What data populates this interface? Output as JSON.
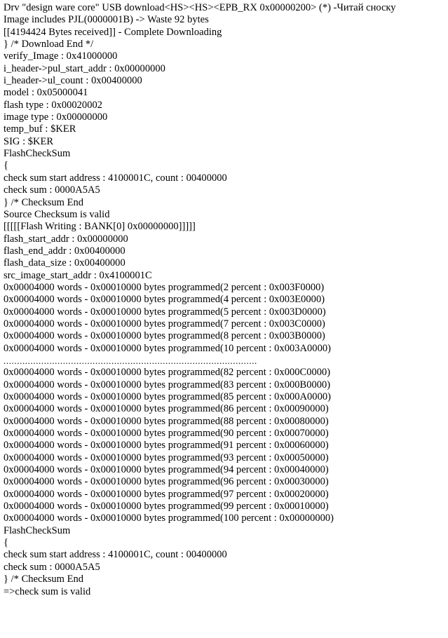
{
  "window": {
    "title": "Flash Download Console Log",
    "background_color": "#ffffff",
    "text_color": "#000000"
  },
  "console": {
    "name": "flash-download-log",
    "line_count": 48,
    "lines": [
      "Drv \"design ware core\" USB download<HS><HS><EPB_RX 0x00000200> (*) -Читай сноску",
      "Image includes PJL(0000001B) -> Waste 92 bytes",
      "[[4194424 Bytes received]] - Complete Downloading",
      "} /* Download End */",
      "verify_Image : 0x41000000",
      "i_header->pul_start_addr : 0x00000000",
      "i_header->ul_count : 0x00400000",
      "model : 0x05000041",
      "flash type : 0x00020002",
      "image type : 0x00000000",
      "temp_buf : $KER",
      "SIG : $KER",
      "FlashCheckSum",
      "{",
      "check sum start address : 4100001C, count : 00400000",
      "check sum : 0000A5A5",
      "} /* Checksum End",
      "Source Checksum is valid",
      "[[[[[Flash Writing : BANK[0] 0x00000000]]]]]",
      "flash_start_addr : 0x00000000",
      "flash_end_addr : 0x00400000",
      "flash_data_size : 0x00400000",
      "src_image_start_addr : 0x4100001C",
      "0x00004000 words - 0x00010000 bytes programmed(2 percent : 0x003F0000)",
      "0x00004000 words - 0x00010000 bytes programmed(4 percent : 0x003E0000)",
      "0x00004000 words - 0x00010000 bytes programmed(5 percent : 0x003D0000)",
      "0x00004000 words - 0x00010000 bytes programmed(7 percent : 0x003C0000)",
      "0x00004000 words - 0x00010000 bytes programmed(8 percent : 0x003B0000)",
      "0x00004000 words - 0x00010000 bytes programmed(10 percent : 0x003A0000)",
      "..............................................................................................",
      "0x00004000 words - 0x00010000 bytes programmed(82 percent : 0x000C0000)",
      "0x00004000 words - 0x00010000 bytes programmed(83 percent : 0x000B0000)",
      "0x00004000 words - 0x00010000 bytes programmed(85 percent : 0x000A0000)",
      "0x00004000 words - 0x00010000 bytes programmed(86 percent : 0x00090000)",
      "0x00004000 words - 0x00010000 bytes programmed(88 percent : 0x00080000)",
      "0x00004000 words - 0x00010000 bytes programmed(90 percent : 0x00070000)",
      "0x00004000 words - 0x00010000 bytes programmed(91 percent : 0x00060000)",
      "0x00004000 words - 0x00010000 bytes programmed(93 percent : 0x00050000)",
      "0x00004000 words - 0x00010000 bytes programmed(94 percent : 0x00040000)",
      "0x00004000 words - 0x00010000 bytes programmed(96 percent : 0x00030000)",
      "0x00004000 words - 0x00010000 bytes programmed(97 percent : 0x00020000)",
      "0x00004000 words - 0x00010000 bytes programmed(99 percent : 0x00010000)",
      "0x00004000 words - 0x00010000 bytes programmed(100 percent : 0x00000000)",
      "FlashCheckSum",
      "{",
      "check sum start address : 4100001C, count : 00400000",
      "check sum : 0000A5A5",
      "} /* Checksum End",
      "=>check sum is valid"
    ],
    "separator_line_index": 29
  }
}
